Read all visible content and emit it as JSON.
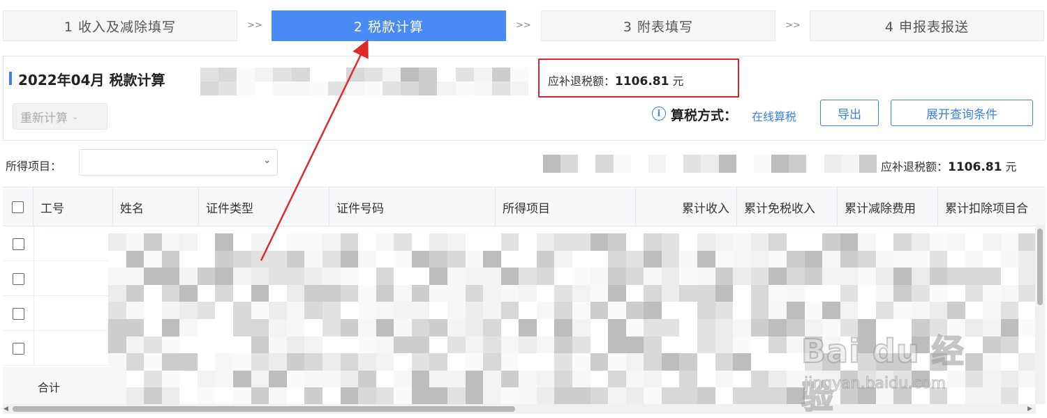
{
  "steps": [
    {
      "label": "1 收入及减除填写",
      "active": false
    },
    {
      "label": "2 税款计算",
      "active": true
    },
    {
      "label": "3 附表填写",
      "active": false
    },
    {
      "label": "4 申报表报送",
      "active": false
    }
  ],
  "step_separator": ">>",
  "header": {
    "title": "2022年04月  税款计算",
    "recalc_button": "重新计算",
    "tax_due_label": "应补退税额：",
    "tax_due_value": "1106.81",
    "tax_due_unit": "元",
    "info_icon": "i",
    "calc_method_label": "算税方式：",
    "calc_method_value": "在线算税",
    "export_button": "导出",
    "expand_query_button": "展开查询条件"
  },
  "filter": {
    "income_item_label": "所得项目：",
    "income_item_value": "",
    "tax_due_label": "应补退税额：",
    "tax_due_value": "1106.81",
    "tax_due_unit": "元"
  },
  "table": {
    "columns": [
      "工号",
      "姓名",
      "证件类型",
      "证件号码",
      "所得项目",
      "累计收入",
      "累计免税收入",
      "累计减除费用",
      "累计扣除项目合"
    ],
    "row_count": 4,
    "total_label": "合计"
  },
  "watermark": {
    "brand": "Bai du 经验",
    "url": "jingyan.baidu.com"
  },
  "colors": {
    "accent": "#4a8af4",
    "link": "#3b7ff0",
    "highlight_box": "#d7262e",
    "annotation_arrow": "#e02a2a"
  },
  "icons": [
    "info-icon",
    "chevron-down-icon",
    "checkbox-icon",
    "arrow-annotation-icon"
  ]
}
